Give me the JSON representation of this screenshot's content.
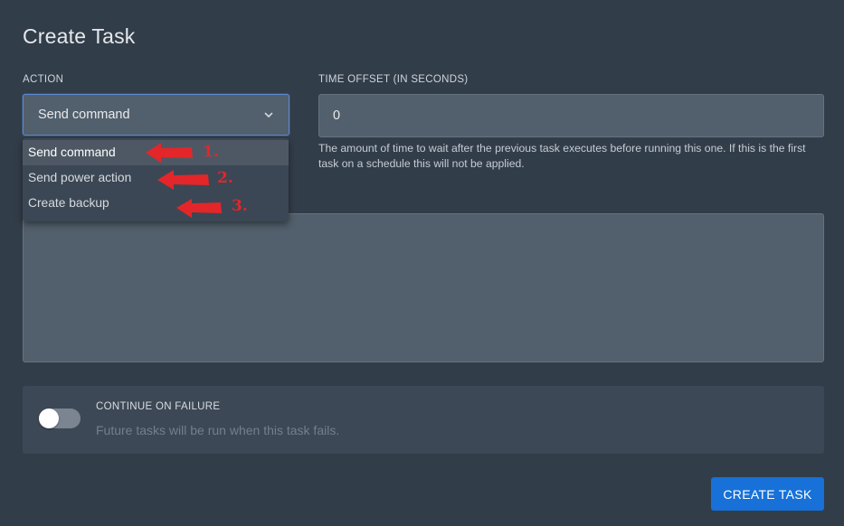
{
  "form": {
    "title": "Create Task",
    "action_label": "ACTION",
    "action_selected": "Send command",
    "time_offset_label": "TIME OFFSET (IN SECONDS)",
    "time_offset_value": "0",
    "time_offset_help": "The amount of time to wait after the previous task executes before running this one. If this is the first task on a schedule this will not be applied.",
    "payload_value": ""
  },
  "action_dropdown": {
    "options": [
      {
        "label": "Send command",
        "selected": true
      },
      {
        "label": "Send power action",
        "selected": false
      },
      {
        "label": "Create backup",
        "selected": false
      }
    ]
  },
  "annotations": [
    "1.",
    "2.",
    "3."
  ],
  "continue_on_failure": {
    "label": "CONTINUE ON FAILURE",
    "description": "Future tasks will be run when this task fails.",
    "enabled": false
  },
  "submit": {
    "label": "CREATE TASK"
  },
  "colors": {
    "background": "#323d4a",
    "input": "#525f6c",
    "focus_border": "#5c8ad4",
    "primary_button": "#1771d8",
    "annotation": "#e3262a"
  },
  "icons": {
    "select_caret": "chevron-down-icon",
    "annotation_marker": "red-arrow-left-icon"
  }
}
